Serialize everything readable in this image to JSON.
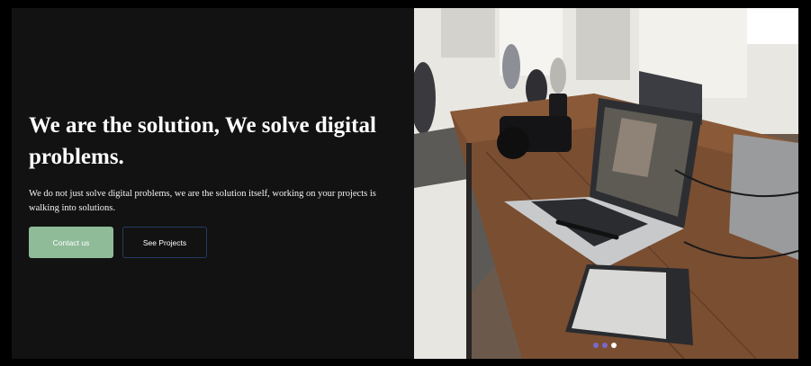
{
  "hero": {
    "headline": "We are the solution, We solve digital problems.",
    "subtext": "We do not just solve digital problems, we are the solution itself, working on your projects is walking into solutions.",
    "primary_button": "Contact us",
    "secondary_button": "See Projects"
  },
  "image": {
    "subject": "laptop-and-camera-on-wooden-desk-photo"
  },
  "carousel": {
    "slide_count": 3,
    "active_slide": 3
  },
  "colors": {
    "background": "#121212",
    "primary_button": "#8fbb99",
    "secondary_button_border": "#243a63",
    "dot_inactive": "#7a68c9",
    "dot_active": "#ffffff"
  }
}
